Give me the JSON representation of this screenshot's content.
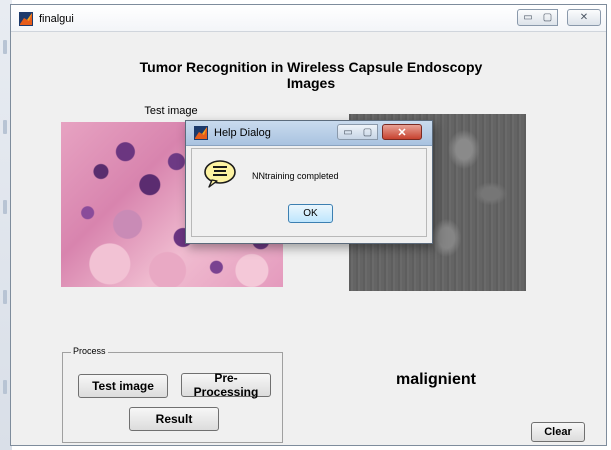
{
  "window": {
    "title": "finalgui",
    "minimize_glyph": "▭",
    "maximize_glyph": "▢",
    "close_glyph": "✕"
  },
  "app": {
    "title_line1": "Tumor Recognition in Wireless Capsule Endoscopy",
    "title_line2": "Images",
    "test_image_label": "Test image"
  },
  "panel": {
    "legend": "Process",
    "buttons": {
      "test_image": "Test image",
      "preprocessing": "Pre-Processing",
      "result": "Result"
    }
  },
  "result_text": "malignient",
  "clear_button": "Clear",
  "dialog": {
    "title": "Help Dialog",
    "message": "NNtraining completed",
    "ok_label": "OK",
    "close_glyph": "✕",
    "minimize_glyph": "▭",
    "maximize_glyph": "▢"
  },
  "colors": {
    "window_bg": "#f0f0f0",
    "dialog_title_bg": "#b4cbe6",
    "close_button": "#c7422f",
    "help_icon_fill": "#fdf3a2"
  },
  "icons": [
    "matlab-icon",
    "help-bubble-icon"
  ]
}
